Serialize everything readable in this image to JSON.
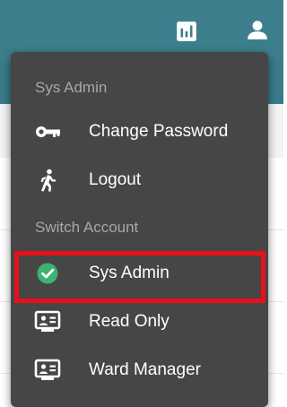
{
  "header": {
    "icons": [
      "bar-chart-icon",
      "user-icon"
    ]
  },
  "menu": {
    "current_user_label": "Sys Admin",
    "items": [
      {
        "label": "Change Password",
        "icon": "key-icon"
      },
      {
        "label": "Logout",
        "icon": "running-person-icon"
      }
    ],
    "switch_account_label": "Switch Account",
    "accounts": [
      {
        "label": "Sys Admin",
        "icon": "check-circle-icon",
        "selected": true
      },
      {
        "label": "Read Only",
        "icon": "account-card-icon",
        "selected": false
      },
      {
        "label": "Ward Manager",
        "icon": "account-card-icon",
        "selected": false
      }
    ]
  },
  "colors": {
    "header": "#3d7e8d",
    "menu_background": "#464646",
    "section_label": "#a8a8a8",
    "selected_check": "#3cb371",
    "highlight": "#e8101a"
  }
}
